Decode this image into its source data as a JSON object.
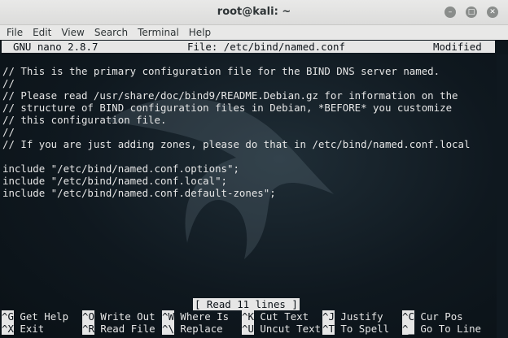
{
  "window": {
    "title": "root@kali: ~"
  },
  "menu": {
    "items": [
      "File",
      "Edit",
      "View",
      "Search",
      "Terminal",
      "Help"
    ]
  },
  "nano": {
    "version": "GNU nano 2.8.7",
    "file": "File: /etc/bind/named.conf",
    "state": "Modified",
    "lines": [
      "// This is the primary configuration file for the BIND DNS server named.",
      "//",
      "// Please read /usr/share/doc/bind9/README.Debian.gz for information on the",
      "// structure of BIND configuration files in Debian, *BEFORE* you customize",
      "// this configuration file.",
      "//",
      "// If you are just adding zones, please do that in /etc/bind/named.conf.local",
      "",
      "include \"/etc/bind/named.conf.options\";",
      "include \"/etc/bind/named.conf.local\";",
      "include \"/etc/bind/named.conf.default-zones\";"
    ],
    "message": "[ Read 11 lines ]",
    "shortcuts_row1": [
      {
        "key": "^G",
        "label": "Get Help"
      },
      {
        "key": "^O",
        "label": "Write Out"
      },
      {
        "key": "^W",
        "label": "Where Is"
      },
      {
        "key": "^K",
        "label": "Cut Text"
      },
      {
        "key": "^J",
        "label": "Justify"
      },
      {
        "key": "^C",
        "label": "Cur Pos"
      }
    ],
    "shortcuts_row2": [
      {
        "key": "^X",
        "label": "Exit"
      },
      {
        "key": "^R",
        "label": "Read File"
      },
      {
        "key": "^\\",
        "label": "Replace"
      },
      {
        "key": "^U",
        "label": "Uncut Text"
      },
      {
        "key": "^T",
        "label": "To Spell"
      },
      {
        "key": "^_",
        "label": "Go To Line"
      }
    ]
  }
}
